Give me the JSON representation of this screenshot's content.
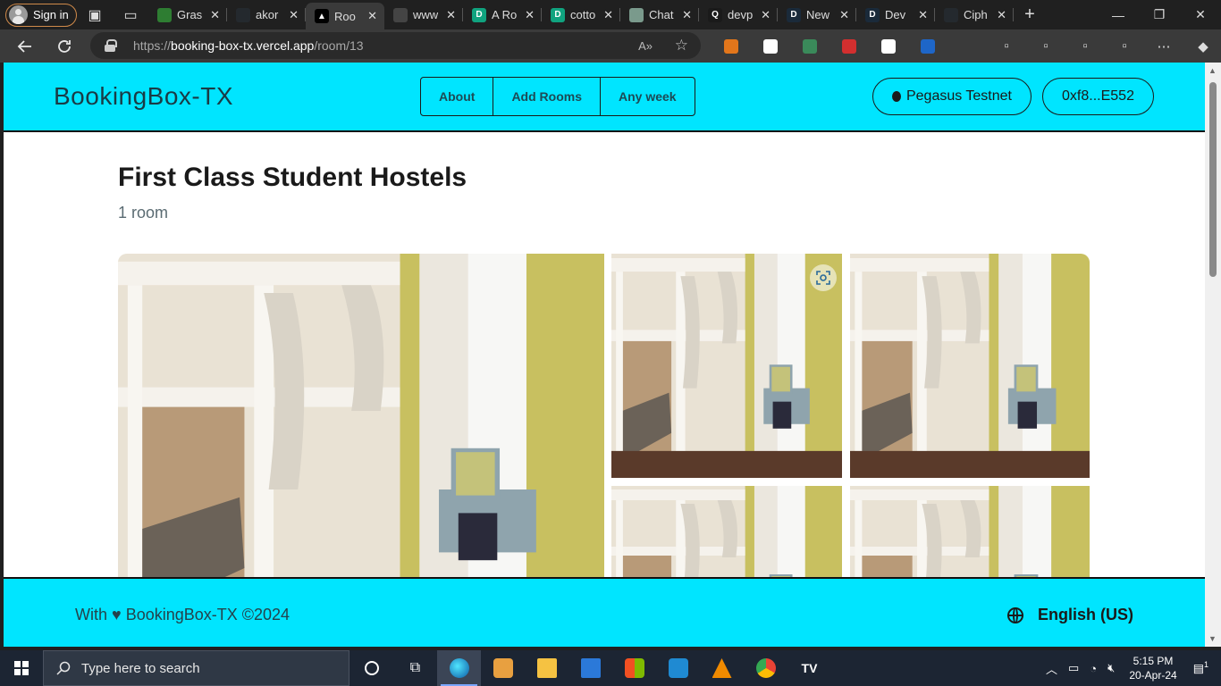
{
  "browser": {
    "signin_label": "Sign in",
    "tabs": [
      {
        "title": "Gras",
        "fav_color": "#2e7d32",
        "fav_text": ""
      },
      {
        "title": "akor",
        "fav_color": "#24292e",
        "fav_text": ""
      },
      {
        "title": "Roo",
        "fav_color": "#000000",
        "fav_text": "▲"
      },
      {
        "title": "www",
        "fav_color": "#444444",
        "fav_text": ""
      },
      {
        "title": "A Ro",
        "fav_color": "#10a37f",
        "fav_text": "D"
      },
      {
        "title": "cotto",
        "fav_color": "#10a37f",
        "fav_text": "D"
      },
      {
        "title": "Chat",
        "fav_color": "#7a9a8c",
        "fav_text": ""
      },
      {
        "title": "devp",
        "fav_color": "#1a1a1a",
        "fav_text": "Q"
      },
      {
        "title": "New",
        "fav_color": "#1a2a3a",
        "fav_text": "D"
      },
      {
        "title": "Dev",
        "fav_color": "#1a2a3a",
        "fav_text": "D"
      },
      {
        "title": "Ciph",
        "fav_color": "#24292e",
        "fav_text": ""
      }
    ],
    "active_tab_index": 2,
    "url_prefix": "https://",
    "url_host": "booking-box-tx.vercel.app",
    "url_path": "/room/13",
    "read_aloud": "A»",
    "extension_colors": [
      "#e2761b",
      "#ffffff",
      "#3a8a5a",
      "#d32f2f",
      "#ffffff",
      "#1e66c8"
    ]
  },
  "site": {
    "brand": "BookingBox-TX",
    "nav": [
      "About",
      "Add Rooms",
      "Any week"
    ],
    "network_label": "Pegasus Testnet",
    "account_label": "0xf8...E552",
    "accent_color": "#00e5ff"
  },
  "listing": {
    "title": "First Class Student Hostels",
    "room_count": "1 room"
  },
  "footer": {
    "left_text": "With ♥ BookingBox-TX ©2024",
    "language": "English (US)"
  },
  "taskbar": {
    "search_placeholder": "Type here to search",
    "time": "5:15 PM",
    "date": "20-Apr-24",
    "notification_count": "1"
  }
}
